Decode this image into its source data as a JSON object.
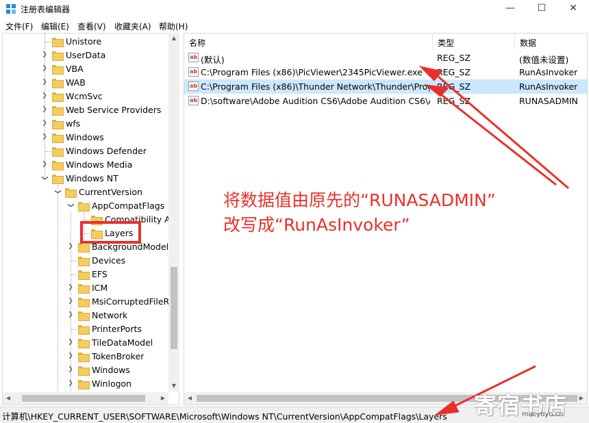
{
  "window": {
    "title": "注册表编辑器",
    "minimize_glyph": "—",
    "maximize_glyph": "☐",
    "close_glyph": "✕"
  },
  "menu": [
    "文件(F)",
    "编辑(E)",
    "查看(V)",
    "收藏夹(A)",
    "帮助(H)"
  ],
  "tree": {
    "items": [
      {
        "label": "Unistore"
      },
      {
        "label": "UserData"
      },
      {
        "label": "VBA"
      },
      {
        "label": "WAB"
      },
      {
        "label": "WcmSvc"
      },
      {
        "label": "Web Service Providers"
      },
      {
        "label": "wfs"
      },
      {
        "label": "Windows"
      },
      {
        "label": "Windows Defender"
      },
      {
        "label": "Windows Media"
      },
      {
        "label": "Windows NT"
      },
      {
        "label": "CurrentVersion"
      },
      {
        "label": "AppCompatFlags"
      },
      {
        "label": "Compatibility As"
      },
      {
        "label": "Layers"
      },
      {
        "label": "BackgroundModel"
      },
      {
        "label": "Devices"
      },
      {
        "label": "EFS"
      },
      {
        "label": "ICM"
      },
      {
        "label": "MsiCorruptedFileRe"
      },
      {
        "label": "Network"
      },
      {
        "label": "PrinterPorts"
      },
      {
        "label": "TileDataModel"
      },
      {
        "label": "TokenBroker"
      },
      {
        "label": "Windows"
      },
      {
        "label": "Winlogon"
      }
    ]
  },
  "list": {
    "columns": [
      "名称",
      "类型",
      "数据"
    ],
    "rows": [
      {
        "name": "(默认)",
        "type": "REG_SZ",
        "data": "(数值未设置)",
        "icon": "ab"
      },
      {
        "name": "C:\\Program Files (x86)\\PicViewer\\2345PicViewer.exe",
        "type": "REG_SZ",
        "data": "RunAsInvoker",
        "icon": "ab"
      },
      {
        "name": "C:\\Program Files (x86)\\Thunder Network\\Thunder\\Progr...",
        "type": "REG_SZ",
        "data": "RunAsInvoker",
        "icon": "ab"
      },
      {
        "name": "D:\\software\\Adobe Audition CS6\\Adobe Audition CS6\\A...",
        "type": "REG_SZ",
        "data": "RUNASADMIN",
        "icon": "ab"
      }
    ]
  },
  "status": {
    "path": "计算机\\HKEY_CURRENT_USER\\SOFTWARE\\Microsoft\\Windows NT\\CurrentVersion\\AppCompatFlags\\Layers"
  },
  "annotation": {
    "line1": "将数据值由原先的“RUNASADMIN”",
    "line2": "改写成“RunAsInvoker”",
    "color": "#e8302a"
  },
  "watermark": {
    "main": "寄宿书店",
    "sub": "macyoyo.cn"
  },
  "colors": {
    "selection": "#cce8ff",
    "folder": "#f5cd5d"
  }
}
